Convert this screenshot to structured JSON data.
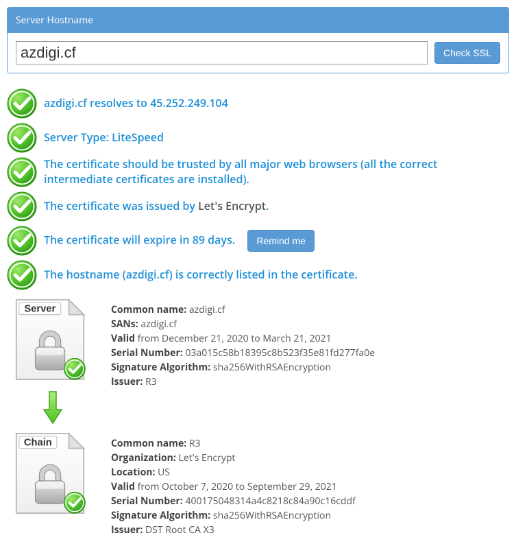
{
  "header": {
    "title": "Server Hostname"
  },
  "search": {
    "value": "azdigi.cf",
    "button": "Check SSL"
  },
  "checks": {
    "resolves": "azdigi.cf resolves to 45.252.249.104",
    "server_type": "Server Type: LiteSpeed",
    "trusted": "The certificate should be trusted by all major web browsers (all the correct intermediate certificates are installed).",
    "issued_prefix": "The certificate was issued by ",
    "issued_by": "Let's Encrypt",
    "issued_suffix": ".",
    "expire": "The certificate will expire in 89 days.",
    "remind_button": "Remind me",
    "hostname_listed": "The hostname (azdigi.cf) is correctly listed in the certificate."
  },
  "server_cert": {
    "badge": "Server",
    "common_name_label": "Common name:",
    "common_name": "azdigi.cf",
    "sans_label": "SANs:",
    "sans": "azdigi.cf",
    "valid_label": "Valid",
    "valid_text": "from December 21, 2020 to March 21, 2021",
    "serial_label": "Serial Number:",
    "serial": "03a015c58b18395c8b523f35e81fd277fa0e",
    "sig_label": "Signature Algorithm:",
    "sig": "sha256WithRSAEncryption",
    "issuer_label": "Issuer:",
    "issuer": "R3"
  },
  "chain_cert": {
    "badge": "Chain",
    "common_name_label": "Common name:",
    "common_name": "R3",
    "org_label": "Organization:",
    "org": "Let's Encrypt",
    "loc_label": "Location:",
    "loc": "US",
    "valid_label": "Valid",
    "valid_text": "from October 7, 2020 to September 29, 2021",
    "serial_label": "Serial Number:",
    "serial": "400175048314a4c8218c84a90c16cddf",
    "sig_label": "Signature Algorithm:",
    "sig": "sha256WithRSAEncryption",
    "issuer_label": "Issuer:",
    "issuer": "DST Root CA X3"
  }
}
